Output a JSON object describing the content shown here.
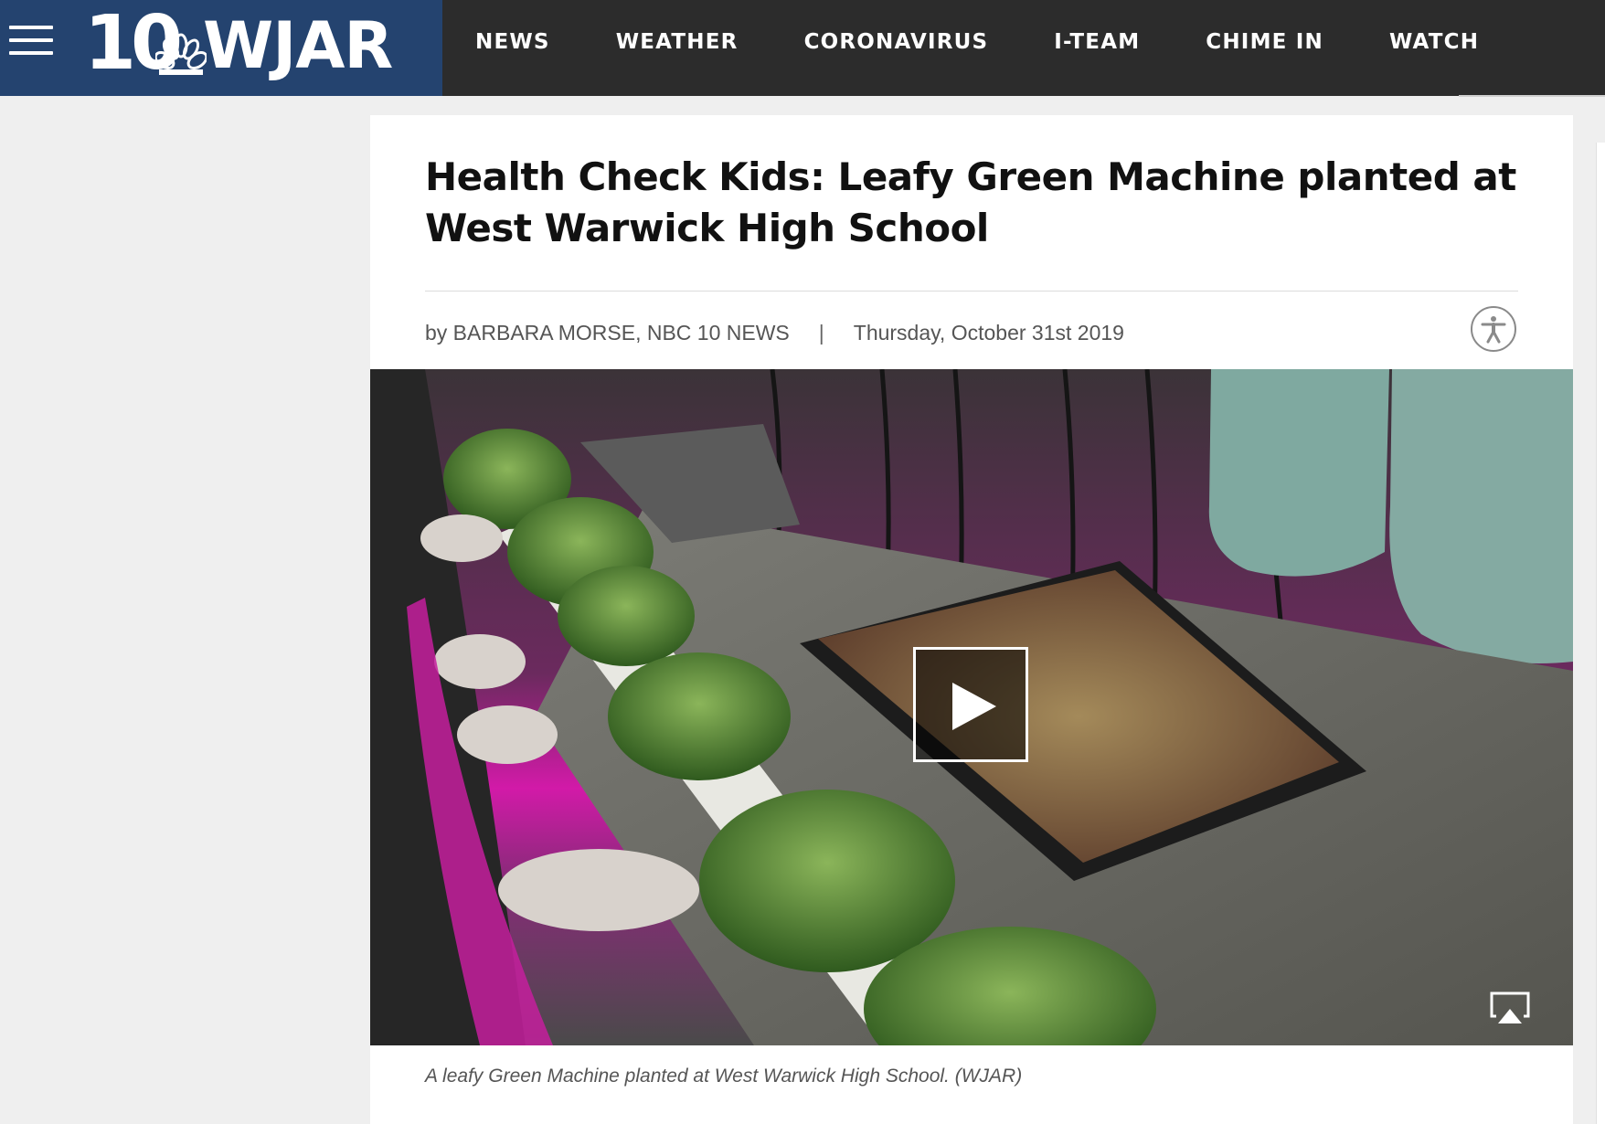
{
  "header": {
    "logo": {
      "number": "10",
      "call_letters": "WJAR",
      "peacock_icon": "nbc-peacock-icon"
    },
    "menu_icon": "hamburger-menu-icon",
    "nav": [
      {
        "label": "NEWS"
      },
      {
        "label": "WEATHER"
      },
      {
        "label": "CORONAVIRUS"
      },
      {
        "label": "I-TEAM"
      },
      {
        "label": "CHIME IN"
      },
      {
        "label": "WATCH"
      }
    ]
  },
  "article": {
    "headline": "Health Check Kids: Leafy Green Machine planted at West Warwick High School",
    "byline": {
      "author": "by BARBARA MORSE, NBC 10 NEWS",
      "separator": "|",
      "date": "Thursday, October 31st 2019"
    },
    "accessibility_icon": "accessibility-icon",
    "video": {
      "play_icon": "play-icon",
      "airplay_icon": "airplay-icon"
    },
    "caption": "A leafy Green Machine planted at West Warwick High School. (WJAR)"
  },
  "colors": {
    "brand_blue": "#24436f",
    "nav_bg": "#2c2c2c",
    "page_bg": "#efefef",
    "headline": "#111111",
    "meta_text": "#555555",
    "grow_light_magenta": "#d21aa8"
  }
}
